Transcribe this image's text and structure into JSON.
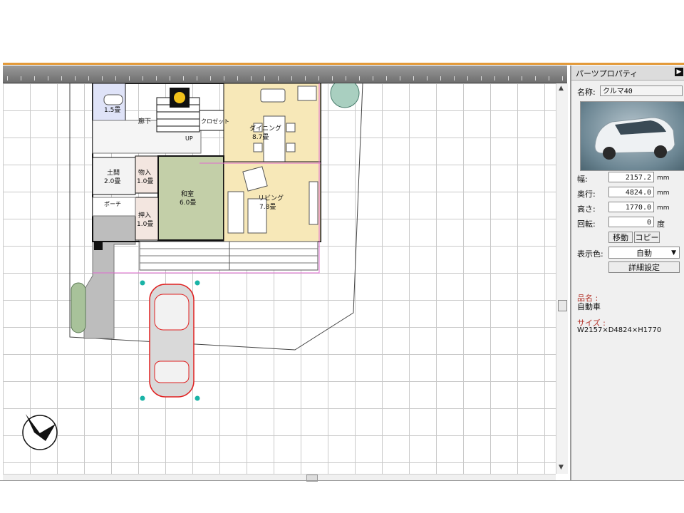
{
  "panel": {
    "title": "パーツプロパティ",
    "name_label": "名称:",
    "name_value": "クルマ40",
    "width_label": "幅:",
    "width_value": "2157.2",
    "depth_label": "奥行:",
    "depth_value": "4824.0",
    "height_label": "高さ:",
    "height_value": "1770.0",
    "unit_mm": "mm",
    "rotation_label": "回転:",
    "rotation_value": "0",
    "rotation_unit": "度",
    "move_button": "移動",
    "copy_button": "コピー",
    "color_label": "表示色:",
    "color_value": "自動",
    "detail_button": "詳細設定",
    "product_label": "品名 :",
    "product_value": "自動車",
    "size_label": "サイズ :",
    "size_value": "W2157×D4824×H1770"
  },
  "plan": {
    "rooms": {
      "toilet": "1.5畳",
      "hallway": "廊下",
      "closet": "クロゼット",
      "dining": "ダイニング",
      "dining_size": "8.7畳",
      "doma": "土間",
      "doma_size": "2.0畳",
      "storage": "物入",
      "storage_size": "1.0畳",
      "washitsu": "和室",
      "washitsu_size": "6.0畳",
      "living": "リビング",
      "living_size": "7.8畳",
      "oshiire": "押入",
      "oshiire_size": "1.0畳",
      "porch": "ポーチ",
      "ud": "UP"
    }
  },
  "colors": {
    "accent": "#e39a3a",
    "car_outline": "#e02020",
    "selection_handle": "#19b3a6",
    "room_floor_wood": "#f7e8b8",
    "tatami": "#c3cfa8"
  }
}
